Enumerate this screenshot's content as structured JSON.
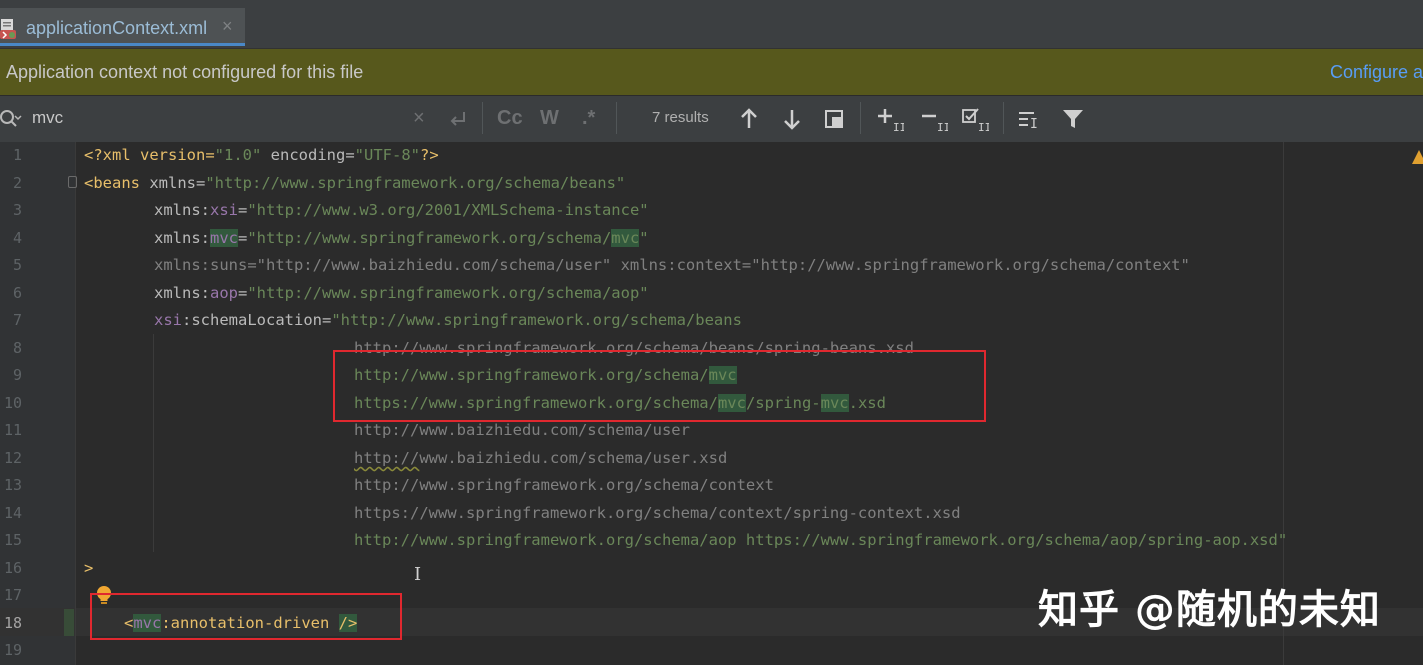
{
  "tab": {
    "label": "applicationContext.xml",
    "close": "×"
  },
  "banner": {
    "message": "Application context not configured for this file",
    "link": "Configure a"
  },
  "find": {
    "query": "mvc",
    "clear": "×",
    "case_label": "Cc",
    "word_label": "W",
    "regex_label": ".*",
    "results": "7 results"
  },
  "line_numbers": [
    "1",
    "2",
    "3",
    "4",
    "5",
    "6",
    "7",
    "8",
    "9",
    "10",
    "11",
    "12",
    "13",
    "14",
    "15",
    "16",
    "17",
    "18",
    "19"
  ],
  "code": {
    "l1": {
      "a": "<?xml version=",
      "b": "\"1.0\"",
      "c": " encoding=",
      "d": "\"UTF-8\"",
      "e": "?>"
    },
    "l2": {
      "a": "<beans ",
      "b": "xmlns=",
      "c": "\"http://www.springframework.org/schema/beans\""
    },
    "l3": {
      "a": "xmlns:",
      "b": "xsi",
      "c": "=",
      "d": "\"http://www.w3.org/2001/XMLSchema-instance\""
    },
    "l4": {
      "a": "xmlns:",
      "b": "mvc",
      "c": "=",
      "d": "\"http://www.springframework.org/schema/",
      "e": "mvc",
      "f": "\""
    },
    "l5": {
      "a": "xmlns:suns=\"http://www.baizhiedu.com/schema/user\" xmlns:context=\"http://www.springframework.org/schema/context\""
    },
    "l6": {
      "a": "xmlns:",
      "b": "aop",
      "c": "=",
      "d": "\"http://www.springframework.org/schema/aop\""
    },
    "l7": {
      "a": "xsi",
      "b": ":schemaLocation=",
      "c": "\"http://www.springframework.org/schema/beans"
    },
    "l8": {
      "a": "http://www.springframework.org/schema/beans/spring-beans.xsd"
    },
    "l9": {
      "a": "http://www.springframework.org/schema/",
      "b": "mvc"
    },
    "l10": {
      "a": "https://www.springframework.org/schema/",
      "b": "mvc",
      "c": "/spring-",
      "d": "mvc",
      "e": ".xsd"
    },
    "l11": {
      "a": "http://www.baizhiedu.com/schema/user"
    },
    "l12": {
      "a": "http://",
      "b": "www.baizhiedu.com/schema/user.xsd"
    },
    "l13": {
      "a": "http://www.springframework.org/schema/context"
    },
    "l14": {
      "a": "https://www.springframework.org/schema/context/spring-context.xsd"
    },
    "l15": {
      "a": "http://www.springframework.org/schema/aop https://www.springframework.org/schema/aop/spring-aop.xsd\""
    },
    "l16": {
      "a": ">"
    },
    "l18": {
      "a": "<",
      "b": "mvc",
      "c": ":annotation-driven ",
      "d": "/>"
    }
  },
  "watermark": "知乎 @随机的未知",
  "colors": {
    "tag": "#e8bf6a",
    "string": "#6a8759",
    "namespace": "#9876aa",
    "match_highlight": "#32593d",
    "annotation_box": "#e0282f"
  }
}
